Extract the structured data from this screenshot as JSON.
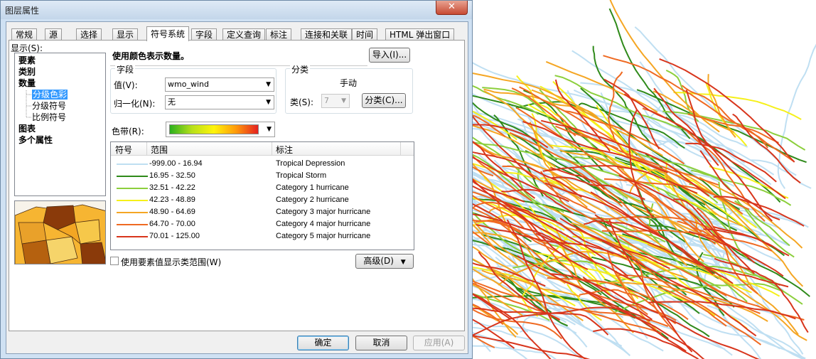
{
  "window": {
    "title": "图层属性",
    "close": "✕"
  },
  "tabs": [
    "常规",
    "源",
    "选择",
    "显示",
    "符号系统",
    "字段",
    "定义查询",
    "标注",
    "连接和关联",
    "时间",
    "HTML 弹出窗口"
  ],
  "active_tab": "符号系统",
  "show_label": "显示(S):",
  "tree": {
    "features": "要素",
    "categories": "类别",
    "quantities": "数量",
    "graduated_colors": "分级色彩",
    "graduated_symbols": "分级符号",
    "proportional_symbols": "比例符号",
    "charts": "图表",
    "multiple_attributes": "多个属性"
  },
  "heading": "使用颜色表示数量。",
  "import_button": "导入(I)...",
  "fields_group": {
    "title": "字段",
    "value_label": "值(V):",
    "value": "wmo_wind",
    "normalization_label": "归一化(N):",
    "normalization": "无"
  },
  "classification_group": {
    "title": "分类",
    "method": "手动",
    "classes_label": "类(S):",
    "classes": "7",
    "classify_button": "分类(C)..."
  },
  "color_ramp_label": "色带(R):",
  "table": {
    "headers": [
      "符号",
      "范围",
      "标注"
    ],
    "rows": [
      {
        "color": "#bfdff2",
        "range": "-999.00 - 16.94",
        "label": "Tropical Depression"
      },
      {
        "color": "#2f8a1a",
        "range": "16.95 - 32.50",
        "label": "Tropical Storm"
      },
      {
        "color": "#8ccf3c",
        "range": "32.51 - 42.22",
        "label": "Category 1 hurricane"
      },
      {
        "color": "#f6f01a",
        "range": "42.23 - 48.89",
        "label": "Category 2 hurricane"
      },
      {
        "color": "#f5a623",
        "range": "48.90 - 64.69",
        "label": "Category 3 major hurricane"
      },
      {
        "color": "#ef6a22",
        "range": "64.70 - 70.00",
        "label": "Category 4 major hurricane"
      },
      {
        "color": "#d8351c",
        "range": "70.01 - 125.00",
        "label": "Category 5 major hurricane"
      }
    ]
  },
  "show_class_ranges": "使用要素值显示类范围(W)",
  "advanced_button": "高级(D)",
  "footer": {
    "ok": "确定",
    "cancel": "取消",
    "apply": "应用(A)"
  },
  "colors": {
    "track_light_blue": "#bfdff2",
    "track_green": "#2f8a1a",
    "track_lightgreen": "#8ccf3c",
    "track_yellow": "#f6f01a",
    "track_orange": "#f5a623",
    "track_darkorange": "#ef6a22",
    "track_red": "#d8351c"
  }
}
